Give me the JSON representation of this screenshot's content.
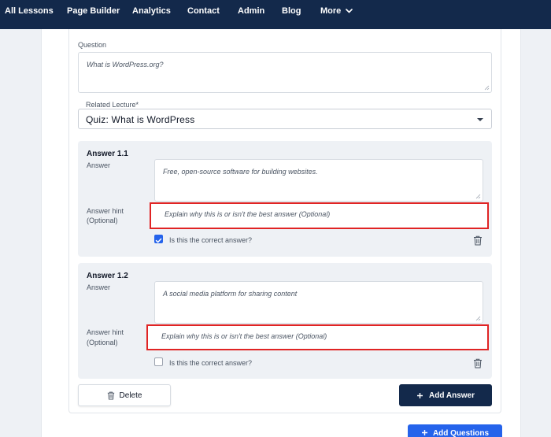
{
  "nav": {
    "items": [
      "All Lessons",
      "Page Builder",
      "Analytics",
      "Contact",
      "Admin",
      "Blog",
      "More"
    ]
  },
  "question": {
    "label": "Question",
    "value": "What is WordPress.org?"
  },
  "related_lecture": {
    "label": "Related Lecture*",
    "selected": "Quiz: What is WordPress"
  },
  "answers": [
    {
      "title": "Answer 1.1",
      "answer_label": "Answer",
      "value": "Free, open-source software for building websites.",
      "hint_label_1": "Answer hint",
      "hint_label_2": "(Optional)",
      "hint_placeholder": "Explain why this is or isn't the best answer (Optional)",
      "correct_label": "Is this the correct answer?",
      "correct": true
    },
    {
      "title": "Answer 1.2",
      "answer_label": "Answer",
      "value": "A social media platform for sharing content",
      "hint_label_1": "Answer hint",
      "hint_label_2": "(Optional)",
      "hint_placeholder": "Explain why this is or isn't the best answer (Optional)",
      "correct_label": "Is this the correct answer?",
      "correct": false
    }
  ],
  "buttons": {
    "delete": "Delete",
    "add_answer": "Add Answer",
    "add_questions": "Add Questions"
  },
  "colors": {
    "nav_bg": "#13294b",
    "primary": "#2563eb",
    "highlight_border": "#e02424"
  },
  "icons": [
    "chevron-down-icon",
    "caret-down-icon",
    "checkmark-icon",
    "trash-icon",
    "plus-icon"
  ]
}
